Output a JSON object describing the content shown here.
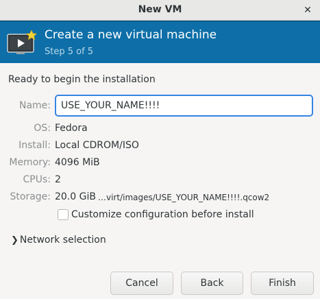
{
  "window": {
    "title": "New VM"
  },
  "header": {
    "title": "Create a new virtual machine",
    "subtitle": "Step 5 of 5"
  },
  "summary": {
    "ready_text": "Ready to begin the installation",
    "name_label": "Name:",
    "name_value": "USE_YOUR_NAME!!!!",
    "os_label": "OS:",
    "os_value": "Fedora",
    "install_label": "Install:",
    "install_value": "Local CDROM/ISO",
    "memory_label": "Memory:",
    "memory_value": "4096 MiB",
    "cpus_label": "CPUs:",
    "cpus_value": "2",
    "storage_label": "Storage:",
    "storage_value": "20.0 GiB",
    "storage_path": "…virt/images/USE_YOUR_NAME!!!!.qcow2"
  },
  "options": {
    "customize_label": "Customize configuration before install",
    "customize_checked": false,
    "network_label": "Network selection"
  },
  "buttons": {
    "cancel": "Cancel",
    "back": "Back",
    "finish": "Finish"
  },
  "colors": {
    "header_band": "#0e6fa8",
    "input_focus": "#3584e4"
  }
}
